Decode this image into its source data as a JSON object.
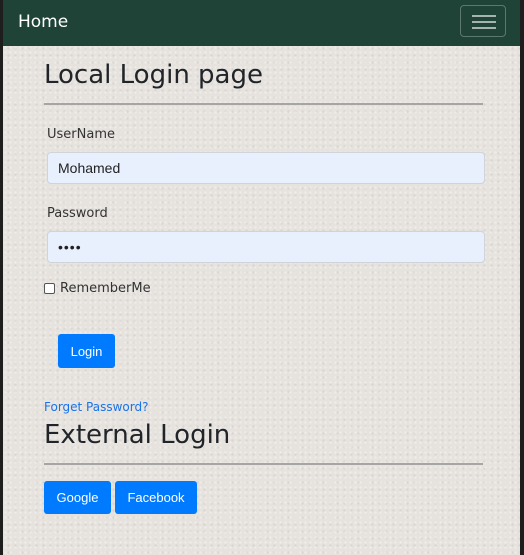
{
  "nav": {
    "brand": "Home",
    "menu_icon": "hamburger-icon"
  },
  "local_login": {
    "title": "Local Login page",
    "username_label": "UserName",
    "username_value": "Mohamed",
    "password_label": "Password",
    "password_value": "••••",
    "remember_label": "RememberMe",
    "remember_checked": false,
    "login_button": "Login",
    "forget_link": "Forget Password?"
  },
  "external_login": {
    "title": "External Login",
    "buttons": [
      "Google",
      "Facebook"
    ]
  },
  "colors": {
    "navbar": "#1f4437",
    "primary": "#007bff",
    "link": "#1a73e8",
    "input_bg": "#e8f0fe"
  }
}
